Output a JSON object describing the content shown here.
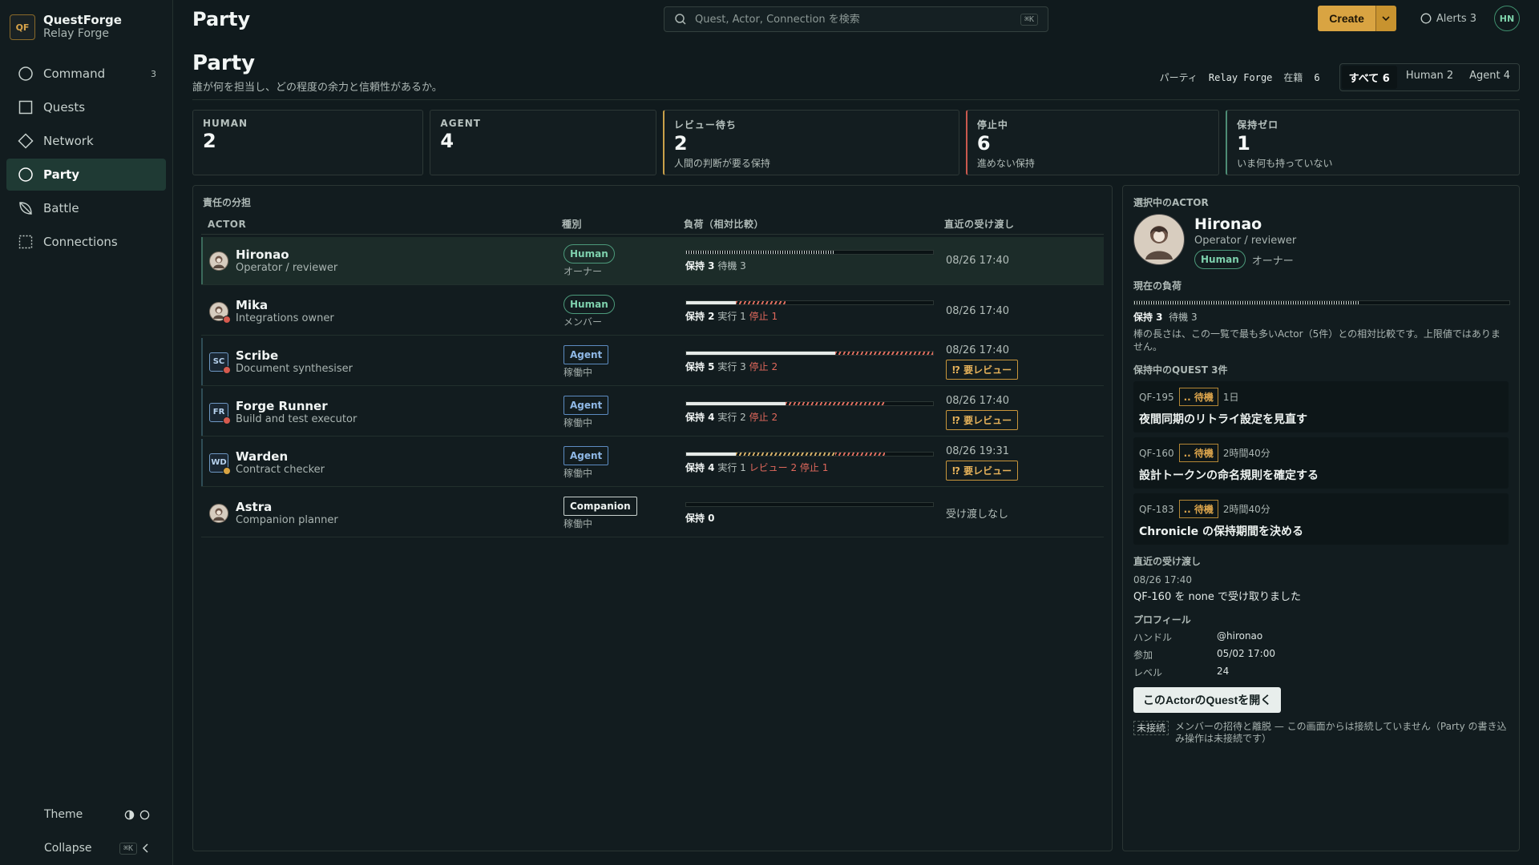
{
  "brand": {
    "logo": "QF",
    "name": "QuestForge",
    "sub": "Relay Forge"
  },
  "nav": [
    {
      "label": "Command",
      "icon": "circle-icon",
      "badge": "3"
    },
    {
      "label": "Quests",
      "icon": "square-icon",
      "badge": ""
    },
    {
      "label": "Network",
      "icon": "diamond-icon",
      "badge": ""
    },
    {
      "label": "Party",
      "icon": "circle-icon",
      "badge": "",
      "active": true
    },
    {
      "label": "Battle",
      "icon": "leaf-icon",
      "badge": ""
    },
    {
      "label": "Connections",
      "icon": "dashed-square-icon",
      "badge": ""
    }
  ],
  "sidebar_bottom": {
    "theme_label": "Theme",
    "collapse_label": "Collapse",
    "collapse_kbd": "⌘K"
  },
  "topbar": {
    "title": "Party",
    "search_placeholder": "Quest, Actor, Connection を検索",
    "search_kbd": "⌘K",
    "create_label": "Create",
    "alerts_label": "Alerts 3",
    "user_initials": "HN"
  },
  "page": {
    "title": "Party",
    "subtitle": "誰が何を担当し、どの程度の余力と信頼性があるか。",
    "meta_party_label": "パーティ",
    "meta_party_value": "Relay Forge",
    "meta_member_label": "在籍",
    "meta_member_value": "6",
    "filters": [
      "すべて 6",
      "Human 2",
      "Agent 4"
    ]
  },
  "stats": [
    {
      "label": "HUMAN",
      "value": "2",
      "desc": ""
    },
    {
      "label": "AGENT",
      "value": "4",
      "desc": ""
    },
    {
      "label": "レビュー待ち",
      "value": "2",
      "desc": "人間の判断が要る保持"
    },
    {
      "label": "停止中",
      "value": "6",
      "desc": "進めない保持"
    },
    {
      "label": "保持ゼロ",
      "value": "1",
      "desc": "いま何も持っていない"
    }
  ],
  "table": {
    "title": "責任の分担",
    "headers": {
      "actor": "ACTOR",
      "type": "種別",
      "load": "負荷（相対比較）",
      "handoff": "直近の受け渡し"
    },
    "review_label": "⁉ 要レビュー",
    "rows": [
      {
        "name": "Hironao",
        "role": "Operator / reviewer",
        "icon": "avatar-icon",
        "type": "Human",
        "type_sub": "オーナー",
        "hold": "保持 3",
        "extra": [
          {
            "t": "待機 3",
            "c": "plain"
          }
        ],
        "handoff": "08/26 17:40",
        "review": false,
        "dot": "",
        "load": {
          "hold": 3,
          "waiting": 3,
          "running": 0,
          "review": 0,
          "stopped": 0
        }
      },
      {
        "name": "Mika",
        "role": "Integrations owner",
        "icon": "avatar-icon",
        "type": "Human",
        "type_sub": "メンバー",
        "hold": "保持 2",
        "extra": [
          {
            "t": "実行 1",
            "c": "plain"
          },
          {
            "t": "停止 1",
            "c": "stop"
          }
        ],
        "handoff": "08/26 17:40",
        "review": false,
        "dot": "red",
        "load": {
          "hold": 2,
          "waiting": 0,
          "running": 1,
          "review": 0,
          "stopped": 1
        }
      },
      {
        "name": "Scribe",
        "role": "Document synthesiser",
        "icon": "SC",
        "type": "Agent",
        "type_sub": "稼働中",
        "hold": "保持 5",
        "extra": [
          {
            "t": "実行 3",
            "c": "plain"
          },
          {
            "t": "停止 2",
            "c": "stop"
          }
        ],
        "handoff": "08/26 17:40",
        "review": true,
        "dot": "red",
        "load": {
          "hold": 5,
          "waiting": 0,
          "running": 3,
          "review": 0,
          "stopped": 2
        }
      },
      {
        "name": "Forge Runner",
        "role": "Build and test executor",
        "icon": "FR",
        "type": "Agent",
        "type_sub": "稼働中",
        "hold": "保持 4",
        "extra": [
          {
            "t": "実行 2",
            "c": "plain"
          },
          {
            "t": "停止 2",
            "c": "stop"
          }
        ],
        "handoff": "08/26 17:40",
        "review": true,
        "dot": "red",
        "load": {
          "hold": 4,
          "waiting": 0,
          "running": 2,
          "review": 0,
          "stopped": 2
        }
      },
      {
        "name": "Warden",
        "role": "Contract checker",
        "icon": "WD",
        "type": "Agent",
        "type_sub": "稼働中",
        "hold": "保持 4",
        "extra": [
          {
            "t": "実行 1",
            "c": "plain"
          },
          {
            "t": "レビュー 2",
            "c": "stop"
          },
          {
            "t": "停止 1",
            "c": "stop"
          }
        ],
        "handoff": "08/26 19:31",
        "review": true,
        "dot": "amber",
        "load": {
          "hold": 4,
          "waiting": 0,
          "running": 1,
          "review": 2,
          "stopped": 1
        }
      },
      {
        "name": "Astra",
        "role": "Companion planner",
        "icon": "avatar-icon",
        "type": "Companion",
        "type_sub": "稼働中",
        "hold": "保持 0",
        "extra": [],
        "handoff": "受け渡しなし",
        "review": false,
        "dot": "",
        "load": {
          "hold": 0,
          "waiting": 0,
          "running": 0,
          "review": 0,
          "stopped": 0
        }
      }
    ],
    "max_hold": 5
  },
  "detail": {
    "label": "選択中のACTOR",
    "name": "Hironao",
    "role": "Operator / reviewer",
    "type": "Human",
    "type_sub": "オーナー",
    "load_label": "現在の負荷",
    "load_hold": "保持 3",
    "load_wait": "待機 3",
    "load_fraction": 0.6,
    "load_note": "棒の長さは、この一覧で最も多いActor（5件）との相対比較です。上限値ではありません。",
    "quests_label": "保持中のQUEST 3件",
    "quests": [
      {
        "id": "QF-195",
        "status": ".. 待機",
        "age": "1日",
        "title": "夜間同期のリトライ設定を見直す"
      },
      {
        "id": "QF-160",
        "status": ".. 待機",
        "age": "2時間40分",
        "title": "設計トークンの命名規則を確定する"
      },
      {
        "id": "QF-183",
        "status": ".. 待機",
        "age": "2時間40分",
        "title": "Chronicle の保持期間を決める"
      }
    ],
    "handoff_label": "直近の受け渡し",
    "handoff_time": "08/26 17:40",
    "handoff_text": "QF-160 を none で受け取りました",
    "profile_label": "プロフィール",
    "profile": [
      {
        "k": "ハンドル",
        "v": "@hironao"
      },
      {
        "k": "参加",
        "v": "05/02 17:00"
      },
      {
        "k": "レベル",
        "v": "24"
      }
    ],
    "open_button": "このActorのQuestを開く",
    "disconnected_tag": "未接続",
    "disconnected_text": "メンバーの招待と離脱 — この画面からは接続していません（Party の書き込み操作は未接続です）"
  },
  "colors": {
    "accent": "#d9a442",
    "human": "#7ed1ad",
    "agent": "#8fb8e6",
    "stop": "#e0685c",
    "bg": "#101a1d"
  }
}
